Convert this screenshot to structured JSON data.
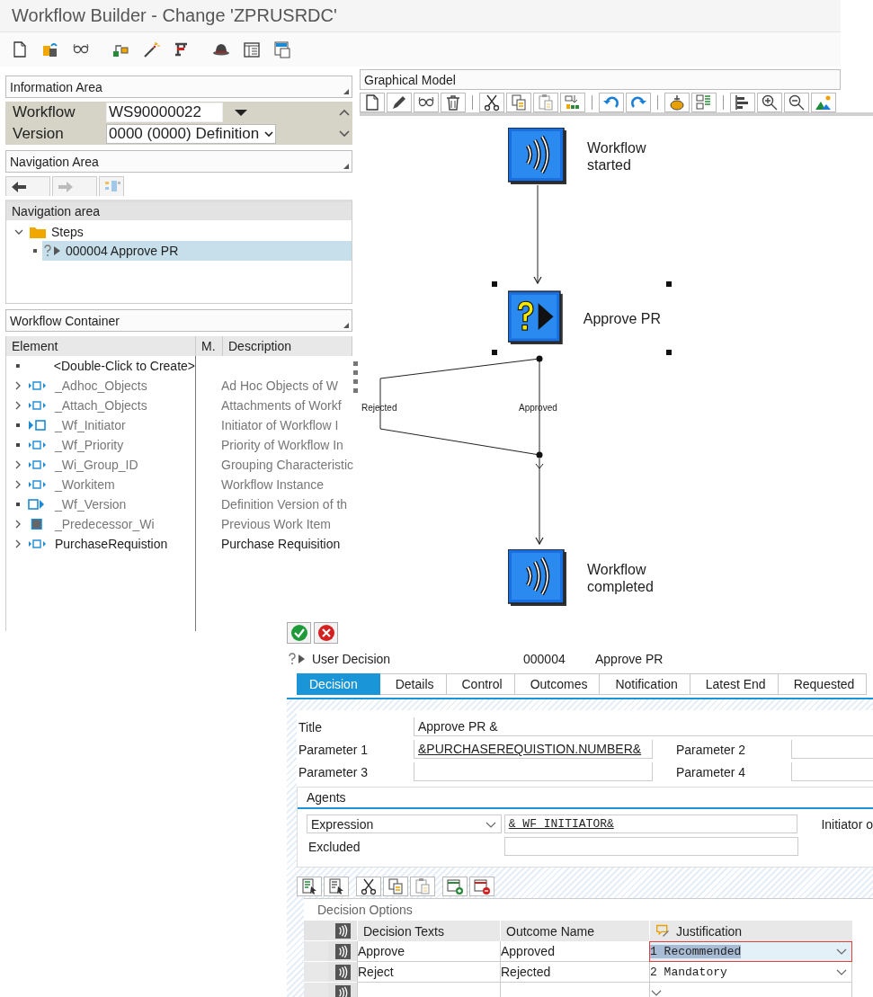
{
  "window": {
    "title": "Workflow Builder - Change 'ZPRUSRDC'"
  },
  "information_area": {
    "title": "Information Area",
    "fields": [
      {
        "label": "Workflow",
        "value": "WS90000022",
        "kind": "input"
      },
      {
        "label": "Version",
        "value": "0000 (0000) Definition",
        "kind": "select"
      }
    ]
  },
  "navigation_area": {
    "title": "Navigation Area",
    "panel_title": "Navigation area",
    "tree": [
      {
        "label": "Steps",
        "expanded": true,
        "selected": false,
        "children": [
          {
            "label": "000004 Approve PR",
            "selected": true
          }
        ]
      }
    ]
  },
  "workflow_container": {
    "title": "Workflow Container",
    "columns": [
      "Element",
      "M.",
      "Description"
    ],
    "rows": [
      {
        "element": "<Double-Click to Create>",
        "expandable": false,
        "kind": "new",
        "system": false
      },
      {
        "element": "_Adhoc_Objects",
        "description": "Ad Hoc Objects of W",
        "expandable": true,
        "kind": "attribute",
        "system": true
      },
      {
        "element": "_Attach_Objects",
        "description": "Attachments of Workf",
        "expandable": true,
        "kind": "attribute",
        "system": true
      },
      {
        "element": "_Wf_Initiator",
        "description": "Initiator of Workflow I",
        "expandable": false,
        "kind": "import",
        "system": true
      },
      {
        "element": "_Wf_Priority",
        "description": "Priority of Workflow In",
        "expandable": false,
        "kind": "attribute",
        "system": true
      },
      {
        "element": "_Wi_Group_ID",
        "description": "Grouping Characteristic",
        "expandable": true,
        "kind": "attribute",
        "system": true
      },
      {
        "element": "_Workitem",
        "description": "Workflow Instance",
        "expandable": true,
        "kind": "attribute",
        "system": true
      },
      {
        "element": "_Wf_Version",
        "description": "Definition Version of th",
        "expandable": false,
        "kind": "export",
        "system": true
      },
      {
        "element": "_Predecessor_Wi",
        "description": "Previous Work Item",
        "expandable": true,
        "kind": "object",
        "system": true
      },
      {
        "element": "PurchaseRequistion",
        "description": "Purchase Requisition",
        "expandable": true,
        "kind": "attribute",
        "system": false
      }
    ]
  },
  "graphical_model": {
    "title": "Graphical Model",
    "nodes": [
      {
        "kind": "event",
        "label": [
          "Workflow",
          "started"
        ],
        "selected": false
      },
      {
        "kind": "decision",
        "label": [
          "Approve PR"
        ],
        "selected": true
      },
      {
        "kind": "event",
        "label": [
          "Workflow",
          "completed"
        ],
        "selected": false
      }
    ],
    "branches": [
      {
        "label": "Rejected"
      },
      {
        "label": "Approved"
      }
    ]
  },
  "dialog": {
    "step_type": "User Decision",
    "step_number": "000004",
    "step_name": "Approve PR",
    "tabs": [
      {
        "label": "Decision",
        "selected": true
      },
      {
        "label": "Details",
        "selected": false
      },
      {
        "label": "Control",
        "selected": false
      },
      {
        "label": "Outcomes",
        "selected": false
      },
      {
        "label": "Notification",
        "selected": false
      },
      {
        "label": "Latest End",
        "selected": false
      },
      {
        "label": "Requested",
        "selected": false
      }
    ],
    "title_label": "Title",
    "title_value": "Approve PR &",
    "parameters": [
      {
        "label": "Parameter 1",
        "value": "&PURCHASEREQUISTION.NUMBER&"
      },
      {
        "label": "Parameter 2"
      },
      {
        "label": "Parameter 3"
      },
      {
        "label": "Parameter 4"
      }
    ],
    "agents": {
      "title": "Agents",
      "type": "Expression",
      "expression": "&_WF_INITIATOR&",
      "description": "Initiator o",
      "excluded_label": "Excluded"
    },
    "decision_options": {
      "title": "Decision Options",
      "columns": [
        "Decision Texts",
        "Outcome Name",
        "Justification"
      ],
      "rows": [
        {
          "text": "Approve",
          "outcome": "Approved",
          "justification": "1 Recommended",
          "selected": true
        },
        {
          "text": "Reject",
          "outcome": "Rejected",
          "justification": "2 Mandatory",
          "selected": false
        },
        {
          "selected": false
        }
      ]
    }
  }
}
